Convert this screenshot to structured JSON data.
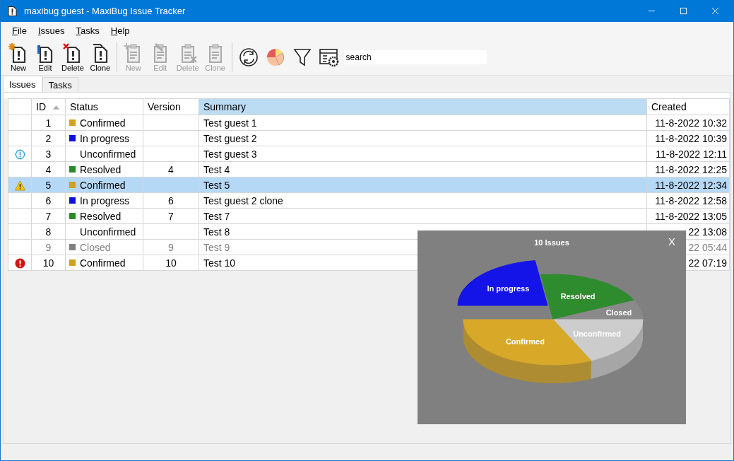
{
  "window": {
    "title": "maxibug guest - MaxiBug Issue Tracker"
  },
  "menu": [
    "File",
    "Issues",
    "Tasks",
    "Help"
  ],
  "toolbar": {
    "buttons": [
      {
        "kind": "new",
        "label": "New",
        "disabled": false
      },
      {
        "kind": "edit",
        "label": "Edit",
        "disabled": false
      },
      {
        "kind": "delete",
        "label": "Delete",
        "disabled": false
      },
      {
        "kind": "clone",
        "label": "Clone",
        "disabled": false
      },
      {
        "kind": "new",
        "label": "New",
        "disabled": true
      },
      {
        "kind": "edit",
        "label": "Edit",
        "disabled": true
      },
      {
        "kind": "delete",
        "label": "Delete",
        "disabled": true
      },
      {
        "kind": "clone",
        "label": "Clone",
        "disabled": true
      }
    ],
    "search": {
      "value": "search"
    }
  },
  "tabs": [
    {
      "label": "Issues",
      "selected": true
    },
    {
      "label": "Tasks",
      "selected": false
    }
  ],
  "table": {
    "columns": [
      {
        "label": "ID",
        "sorted": true,
        "selected": false
      },
      {
        "label": "Status",
        "sorted": false,
        "selected": false
      },
      {
        "label": "Version",
        "sorted": false,
        "selected": false
      },
      {
        "label": "Summary",
        "sorted": false,
        "selected": true
      },
      {
        "label": "Created",
        "sorted": false,
        "selected": false
      }
    ],
    "rows": [
      {
        "kind": "plain",
        "id": "1",
        "status": "Confirmed",
        "color": "#d4a020",
        "summary": "Test guest 1",
        "created": "11-8-2022 10:32",
        "selected": false,
        "dimmed": false
      },
      {
        "kind": "plain",
        "id": "2",
        "status": "In progress",
        "color": "#1010e0",
        "summary": "Test guest 2",
        "created": "11-8-2022 10:39",
        "selected": false,
        "dimmed": false
      },
      {
        "kind": "info",
        "id": "3",
        "status": "Unconfirmed",
        "summary": "Test guest 3",
        "created": "11-8-2022 12:11",
        "selected": false,
        "dimmed": false
      },
      {
        "kind": "plain",
        "id": "4",
        "status": "Resolved",
        "color": "#2a8a2a",
        "version": "4",
        "summary": "Test 4",
        "created": "11-8-2022 12:25",
        "selected": false,
        "dimmed": false
      },
      {
        "kind": "warning",
        "id": "5",
        "status": "Confirmed",
        "color": "#d4a020",
        "summary": "Test 5",
        "created": "11-8-2022 12:34",
        "selected": true,
        "dimmed": false
      },
      {
        "kind": "plain",
        "id": "6",
        "status": "In progress",
        "color": "#1010e0",
        "version": "6",
        "summary": "Test guest 2 clone",
        "created": "11-8-2022 12:58",
        "selected": false,
        "dimmed": false
      },
      {
        "kind": "plain",
        "id": "7",
        "status": "Resolved",
        "color": "#2a8a2a",
        "version": "7",
        "summary": "Test 7",
        "created": "11-8-2022 13:05",
        "selected": false,
        "dimmed": false
      },
      {
        "kind": "plain",
        "id": "8",
        "status": "Unconfirmed",
        "summary": "Test 8",
        "created": "22 13:08",
        "selected": false,
        "dimmed": false
      },
      {
        "kind": "plain",
        "id": "9",
        "status": "Closed",
        "color": "#808080",
        "version": "9",
        "summary": "Test 9",
        "created": "22 05:44",
        "selected": false,
        "dimmed": true
      },
      {
        "kind": "error",
        "id": "10",
        "status": "Confirmed",
        "color": "#d4a020",
        "version": "10",
        "summary": "Test 10",
        "created": "22 07:19",
        "selected": false,
        "dimmed": false
      }
    ]
  },
  "chart_popup": {
    "title": "10 Issues",
    "close": "X",
    "slices": [
      {
        "label": "In progress",
        "color": "#1414e8",
        "exploded": true
      },
      {
        "label": "Resolved",
        "color": "#2e8b2e",
        "exploded": false
      },
      {
        "label": "Closed",
        "color": "#8a8a8a",
        "exploded": false
      },
      {
        "label": "Unconfirmed",
        "color": "#cccccc",
        "exploded": false
      },
      {
        "label": "Confirmed",
        "color": "#d8a828",
        "exploded": false
      }
    ]
  }
}
